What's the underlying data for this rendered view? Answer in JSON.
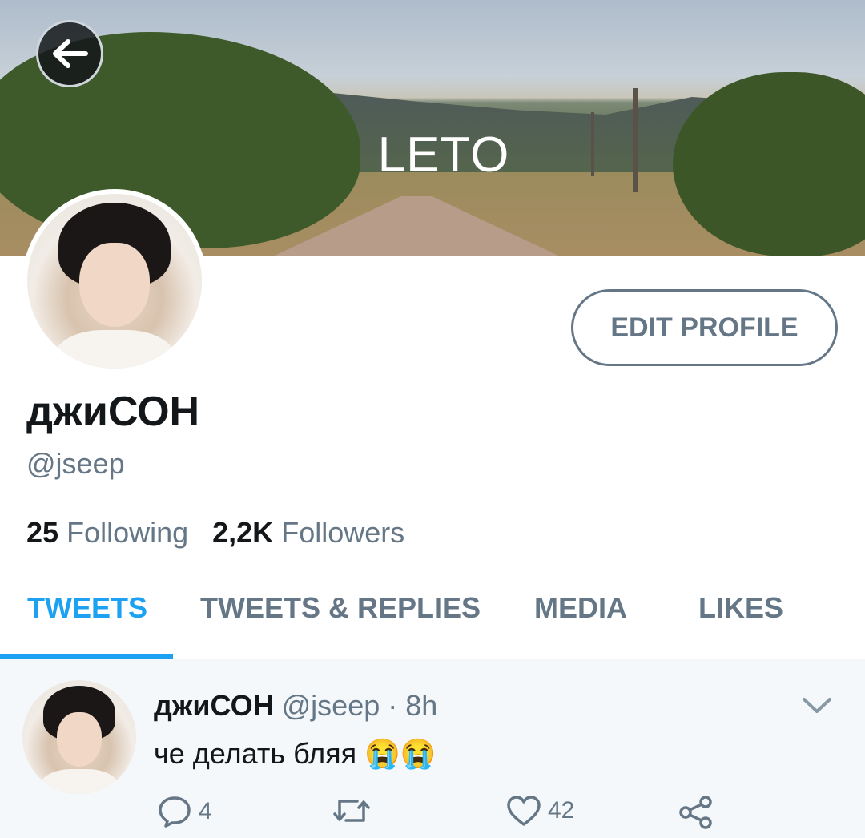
{
  "banner": {
    "title": "LETO"
  },
  "back_button": {
    "icon": "arrow-left-icon"
  },
  "profile": {
    "display_name": "джиСОН",
    "handle": "@jseep",
    "following_count": "25",
    "following_label": "Following",
    "followers_count": "2,2K",
    "followers_label": "Followers",
    "edit_label": "EDIT PROFILE"
  },
  "tabs": [
    {
      "label": "TWEETS",
      "active": true
    },
    {
      "label": "TWEETS & REPLIES",
      "active": false
    },
    {
      "label": "MEDIA",
      "active": false
    },
    {
      "label": "LIKES",
      "active": false
    }
  ],
  "tweet": {
    "name": "джиСОН",
    "handle": "@jseep",
    "separator": "·",
    "time": "8h",
    "text": "че делать бляя 😭😭",
    "replies": "4",
    "retweets": "",
    "likes": "42"
  },
  "colors": {
    "accent": "#1da1f2",
    "secondary_text": "#657786",
    "primary_text": "#14171a"
  }
}
